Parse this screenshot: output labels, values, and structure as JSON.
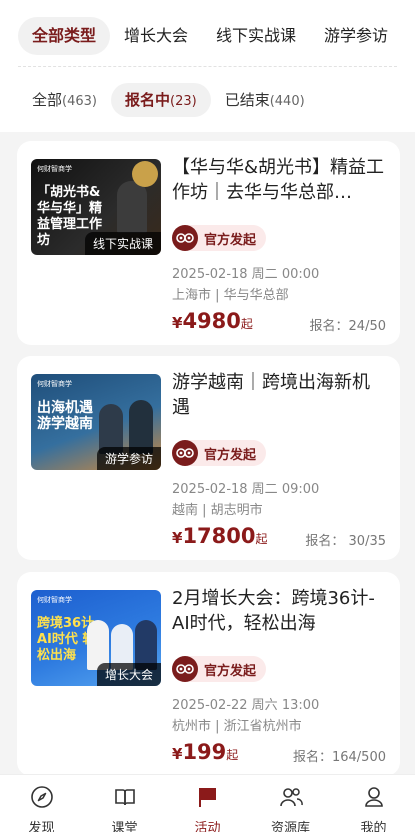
{
  "type_tabs": [
    {
      "label": "全部类型",
      "active": true
    },
    {
      "label": "增长大会",
      "active": false
    },
    {
      "label": "线下实战课",
      "active": false
    },
    {
      "label": "游学参访",
      "active": false
    }
  ],
  "status_tabs": [
    {
      "label": "全部",
      "count": "(463)",
      "active": false
    },
    {
      "label": "报名中",
      "count": "(23)",
      "active": true
    },
    {
      "label": "已结束",
      "count": "(440)",
      "active": false
    }
  ],
  "cards": [
    {
      "thumb_tag": "线下实战课",
      "thumb_brand": "何财智商学",
      "thumb_headline": "「胡光书&华与华」精益管理工作坊",
      "thumb_bg": "#1a1a1a",
      "title": "【华与华&胡光书】精益工作坊｜去华与华总部…",
      "badge": "官方发起",
      "date": "2025-02-18 周二 00:00",
      "location": "上海市 | 华与华总部",
      "currency": "¥",
      "price": "4980",
      "price_suffix": "起",
      "signup": "报名：24/50"
    },
    {
      "thumb_tag": "游学参访",
      "thumb_brand": "何财智商学",
      "thumb_headline": "出海机遇 游学越南",
      "thumb_bg": "#2a5d8f",
      "title": "游学越南｜跨境出海新机遇",
      "badge": "官方发起",
      "date": "2025-02-18 周二 09:00",
      "location": "越南 | 胡志明市",
      "currency": "¥",
      "price": "17800",
      "price_suffix": "起",
      "signup": "报名： 30/35"
    },
    {
      "thumb_tag": "增长大会",
      "thumb_brand": "何财智商学",
      "thumb_headline": "跨境36计 AI时代 轻松出海",
      "thumb_bg": "#2563c9",
      "title": "2月增长大会：跨境36计-AI时代，轻松出海",
      "badge": "官方发起",
      "date": "2025-02-22 周六 13:00",
      "location": "杭州市 | 浙江省杭州市",
      "currency": "¥",
      "price": "199",
      "price_suffix": "起",
      "signup": "报名：164/500"
    }
  ],
  "tabbar": [
    {
      "label": "发现",
      "icon": "compass-icon",
      "active": false
    },
    {
      "label": "课堂",
      "icon": "book-icon",
      "active": false
    },
    {
      "label": "活动",
      "icon": "flag-icon",
      "active": true
    },
    {
      "label": "资源库",
      "icon": "people-icon",
      "active": false
    },
    {
      "label": "我的",
      "icon": "person-icon",
      "active": false
    }
  ],
  "colors": {
    "accent": "#8b1a1a",
    "active_bg": "#f1f1f1",
    "badge_bg": "#fbeaea"
  }
}
